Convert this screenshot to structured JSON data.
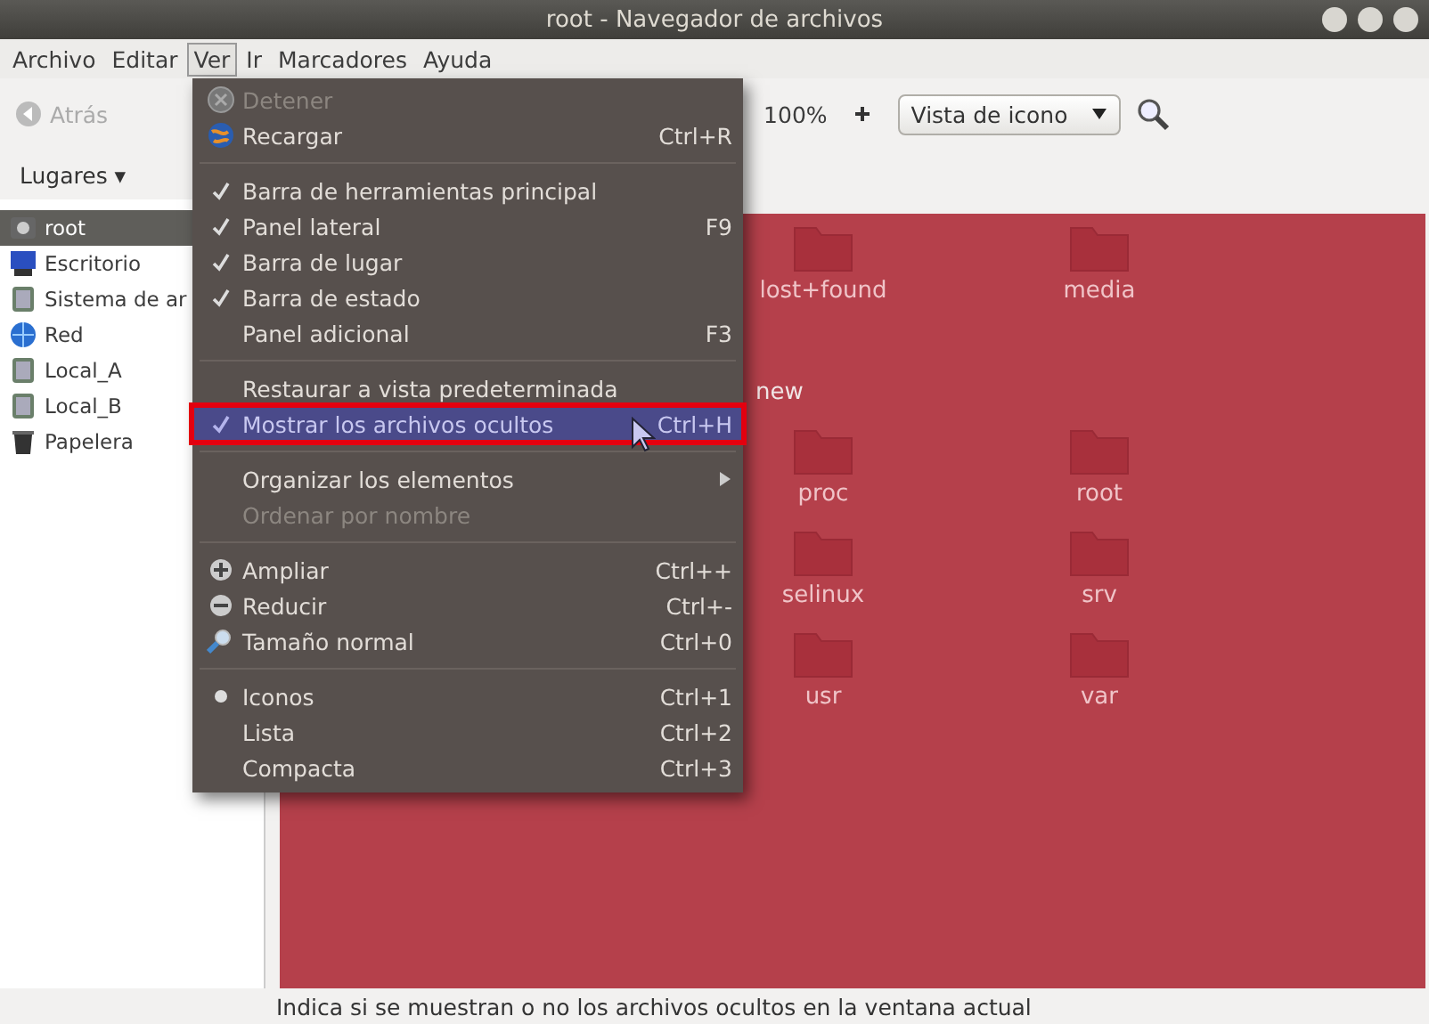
{
  "window": {
    "title": "root - Navegador de archivos"
  },
  "menubar": [
    {
      "label": "Archivo",
      "selected": false
    },
    {
      "label": "Editar",
      "selected": false
    },
    {
      "label": "Ver",
      "selected": true
    },
    {
      "label": "Ir",
      "selected": false
    },
    {
      "label": "Marcadores",
      "selected": false
    },
    {
      "label": "Ayuda",
      "selected": false
    }
  ],
  "toolbar": {
    "back": "Atrás",
    "zoom": "100%",
    "view_select": "Vista de icono"
  },
  "places": {
    "label": "Lugares ▾"
  },
  "sidebar": {
    "items": [
      {
        "label": "root",
        "kind": "home",
        "selected": true
      },
      {
        "label": "Escritorio",
        "kind": "desktop",
        "selected": false
      },
      {
        "label": "Sistema de ar",
        "kind": "drive",
        "selected": false
      },
      {
        "label": "Red",
        "kind": "network",
        "selected": false
      },
      {
        "label": "Local_A",
        "kind": "drive",
        "selected": false
      },
      {
        "label": "Local_B",
        "kind": "drive",
        "selected": false
      },
      {
        "label": "Papelera",
        "kind": "trash",
        "selected": false
      }
    ]
  },
  "content": {
    "rows": [
      [
        "lost+found",
        "media"
      ],
      [
        "new"
      ],
      [
        "proc",
        "root"
      ],
      [
        "selinux",
        "srv"
      ],
      [
        "usr",
        "var"
      ]
    ]
  },
  "view_menu": {
    "items": [
      {
        "kind": "stop",
        "label": "Detener",
        "disabled": true,
        "highlighted": false
      },
      {
        "kind": "reload",
        "label": "Recargar",
        "shortcut": "Ctrl+R",
        "disabled": false,
        "highlighted": false
      },
      {
        "kind": "separator"
      },
      {
        "kind": "check",
        "label": "Barra de herramientas principal",
        "checked": true,
        "disabled": false,
        "highlighted": false
      },
      {
        "kind": "check",
        "label": "Panel lateral",
        "shortcut": "F9",
        "checked": true,
        "disabled": false,
        "highlighted": false
      },
      {
        "kind": "check",
        "label": "Barra de lugar",
        "checked": true,
        "disabled": false,
        "highlighted": false
      },
      {
        "kind": "check",
        "label": "Barra de estado",
        "checked": true,
        "disabled": false,
        "highlighted": false
      },
      {
        "kind": "check",
        "label": "Panel adicional",
        "shortcut": "F3",
        "checked": false,
        "disabled": false,
        "highlighted": false
      },
      {
        "kind": "separator"
      },
      {
        "kind": "plain",
        "label": "Restaurar a vista predeterminada",
        "disabled": false,
        "highlighted": false
      },
      {
        "kind": "check",
        "label": "Mostrar los archivos ocultos",
        "shortcut": "Ctrl+H",
        "checked": true,
        "disabled": false,
        "highlighted": true
      },
      {
        "kind": "separator"
      },
      {
        "kind": "submenu",
        "label": "Organizar los elementos",
        "disabled": false,
        "highlighted": false
      },
      {
        "kind": "plain",
        "label": "Ordenar por nombre",
        "disabled": true,
        "highlighted": false
      },
      {
        "kind": "separator"
      },
      {
        "kind": "zoomin",
        "label": "Ampliar",
        "shortcut": "Ctrl++",
        "disabled": false,
        "highlighted": false
      },
      {
        "kind": "zoomout",
        "label": "Reducir",
        "shortcut": "Ctrl+-",
        "disabled": false,
        "highlighted": false
      },
      {
        "kind": "magnifier",
        "label": "Tamaño normal",
        "shortcut": "Ctrl+0",
        "disabled": false,
        "highlighted": false
      },
      {
        "kind": "separator"
      },
      {
        "kind": "radio",
        "label": "Iconos",
        "shortcut": "Ctrl+1",
        "selected": true,
        "disabled": false,
        "highlighted": false
      },
      {
        "kind": "radio",
        "label": "Lista",
        "shortcut": "Ctrl+2",
        "selected": false,
        "disabled": false,
        "highlighted": false
      },
      {
        "kind": "radio",
        "label": "Compacta",
        "shortcut": "Ctrl+3",
        "selected": false,
        "disabled": false,
        "highlighted": false
      }
    ]
  },
  "status_bar": "Indica si se muestran o no los archivos ocultos en la ventana actual"
}
